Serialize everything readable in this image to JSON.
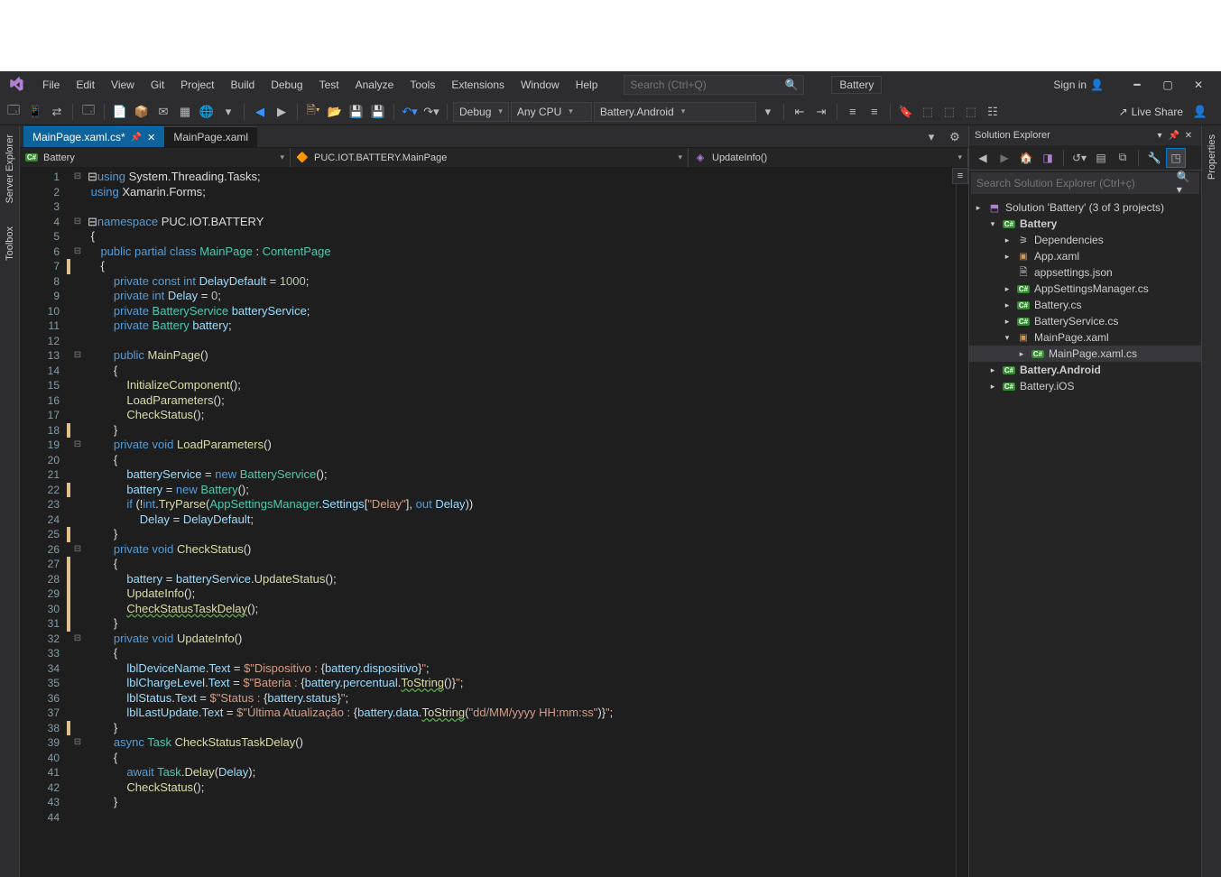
{
  "menu": [
    "File",
    "Edit",
    "View",
    "Git",
    "Project",
    "Build",
    "Debug",
    "Test",
    "Analyze",
    "Tools",
    "Extensions",
    "Window",
    "Help"
  ],
  "search_placeholder": "Search (Ctrl+Q)",
  "solution_name_top": "Battery",
  "sign_in": "Sign in",
  "toolbar": {
    "config": "Debug",
    "platform": "Any CPU",
    "startup": "Battery.Android",
    "live_share": "Live Share"
  },
  "tabs": [
    {
      "label": "MainPage.xaml.cs*",
      "active": true,
      "pinned": true
    },
    {
      "label": "MainPage.xaml",
      "active": false,
      "pinned": false
    }
  ],
  "navbar": {
    "project": "Battery",
    "class": "PUC.IOT.BATTERY.MainPage",
    "member": "UpdateInfo()"
  },
  "code": {
    "total_lines": 44,
    "change_markers_yellow": [
      7,
      18,
      22,
      25,
      27,
      28,
      29,
      30,
      31,
      38
    ],
    "fold_minus": [
      1,
      4,
      6,
      13,
      19,
      26,
      32,
      39
    ],
    "lines": [
      [
        {
          "t": "⊟",
          "c": "pn"
        },
        {
          "t": "using ",
          "c": "kw"
        },
        {
          "t": "System.Threading.Tasks",
          "c": "pn"
        },
        {
          "t": ";",
          "c": "pn"
        }
      ],
      [
        {
          "t": " ",
          "c": "pn"
        },
        {
          "t": "using ",
          "c": "kw"
        },
        {
          "t": "Xamarin.Forms",
          "c": "pn"
        },
        {
          "t": ";",
          "c": "pn"
        }
      ],
      [],
      [
        {
          "t": "⊟",
          "c": "pn"
        },
        {
          "t": "namespace ",
          "c": "kw"
        },
        {
          "t": "PUC.IOT.BATTERY",
          "c": "pn"
        }
      ],
      [
        {
          "t": " {",
          "c": "pn"
        }
      ],
      [
        {
          "t": "    ",
          "c": "pn"
        },
        {
          "t": "public partial class ",
          "c": "kw"
        },
        {
          "t": "MainPage",
          "c": "cls"
        },
        {
          "t": " : ",
          "c": "pn"
        },
        {
          "t": "ContentPage",
          "c": "cls"
        }
      ],
      [
        {
          "t": "    {",
          "c": "pn"
        }
      ],
      [
        {
          "t": "        ",
          "c": "pn"
        },
        {
          "t": "private const int ",
          "c": "kw"
        },
        {
          "t": "DelayDefault",
          "c": "var"
        },
        {
          "t": " = ",
          "c": "pn"
        },
        {
          "t": "1000",
          "c": "num"
        },
        {
          "t": ";",
          "c": "pn"
        }
      ],
      [
        {
          "t": "        ",
          "c": "pn"
        },
        {
          "t": "private int ",
          "c": "kw"
        },
        {
          "t": "Delay",
          "c": "var"
        },
        {
          "t": " = ",
          "c": "pn"
        },
        {
          "t": "0",
          "c": "num"
        },
        {
          "t": ";",
          "c": "pn"
        }
      ],
      [
        {
          "t": "        ",
          "c": "pn"
        },
        {
          "t": "private ",
          "c": "kw"
        },
        {
          "t": "BatteryService ",
          "c": "cls"
        },
        {
          "t": "batteryService",
          "c": "var"
        },
        {
          "t": ";",
          "c": "pn"
        }
      ],
      [
        {
          "t": "        ",
          "c": "pn"
        },
        {
          "t": "private ",
          "c": "kw"
        },
        {
          "t": "Battery ",
          "c": "cls"
        },
        {
          "t": "battery",
          "c": "var"
        },
        {
          "t": ";",
          "c": "pn"
        }
      ],
      [],
      [
        {
          "t": "        ",
          "c": "pn"
        },
        {
          "t": "public ",
          "c": "kw"
        },
        {
          "t": "MainPage",
          "c": "fn"
        },
        {
          "t": "()",
          "c": "pn"
        }
      ],
      [
        {
          "t": "        {",
          "c": "pn"
        }
      ],
      [
        {
          "t": "            ",
          "c": "pn"
        },
        {
          "t": "InitializeComponent",
          "c": "fn"
        },
        {
          "t": "();",
          "c": "pn"
        }
      ],
      [
        {
          "t": "            ",
          "c": "pn"
        },
        {
          "t": "LoadParameters",
          "c": "fn"
        },
        {
          "t": "();",
          "c": "pn"
        }
      ],
      [
        {
          "t": "            ",
          "c": "pn"
        },
        {
          "t": "CheckStatus",
          "c": "fn"
        },
        {
          "t": "();",
          "c": "pn"
        }
      ],
      [
        {
          "t": "        }",
          "c": "pn"
        }
      ],
      [
        {
          "t": "        ",
          "c": "pn"
        },
        {
          "t": "private void ",
          "c": "kw"
        },
        {
          "t": "LoadParameters",
          "c": "fn"
        },
        {
          "t": "()",
          "c": "pn"
        }
      ],
      [
        {
          "t": "        {",
          "c": "pn"
        }
      ],
      [
        {
          "t": "            ",
          "c": "pn"
        },
        {
          "t": "batteryService",
          "c": "var"
        },
        {
          "t": " = ",
          "c": "pn"
        },
        {
          "t": "new ",
          "c": "kw"
        },
        {
          "t": "BatteryService",
          "c": "cls"
        },
        {
          "t": "();",
          "c": "pn"
        }
      ],
      [
        {
          "t": "            ",
          "c": "pn"
        },
        {
          "t": "battery",
          "c": "var"
        },
        {
          "t": " = ",
          "c": "pn"
        },
        {
          "t": "new ",
          "c": "kw"
        },
        {
          "t": "Battery",
          "c": "cls"
        },
        {
          "t": "();",
          "c": "pn"
        }
      ],
      [
        {
          "t": "            ",
          "c": "pn"
        },
        {
          "t": "if ",
          "c": "kw"
        },
        {
          "t": "(!",
          "c": "pn"
        },
        {
          "t": "int",
          "c": "kw"
        },
        {
          "t": ".",
          "c": "pn"
        },
        {
          "t": "TryParse",
          "c": "fn"
        },
        {
          "t": "(",
          "c": "pn"
        },
        {
          "t": "AppSettingsManager",
          "c": "cls"
        },
        {
          "t": ".",
          "c": "pn"
        },
        {
          "t": "Settings",
          "c": "var"
        },
        {
          "t": "[",
          "c": "pn"
        },
        {
          "t": "\"Delay\"",
          "c": "str"
        },
        {
          "t": "], ",
          "c": "pn"
        },
        {
          "t": "out ",
          "c": "kw"
        },
        {
          "t": "Delay",
          "c": "var"
        },
        {
          "t": "))",
          "c": "pn"
        }
      ],
      [
        {
          "t": "                ",
          "c": "pn"
        },
        {
          "t": "Delay",
          "c": "var"
        },
        {
          "t": " = ",
          "c": "pn"
        },
        {
          "t": "DelayDefault",
          "c": "var"
        },
        {
          "t": ";",
          "c": "pn"
        }
      ],
      [
        {
          "t": "        }",
          "c": "pn"
        }
      ],
      [
        {
          "t": "        ",
          "c": "pn"
        },
        {
          "t": "private void ",
          "c": "kw"
        },
        {
          "t": "CheckStatus",
          "c": "fn"
        },
        {
          "t": "()",
          "c": "pn"
        }
      ],
      [
        {
          "t": "        {",
          "c": "pn"
        }
      ],
      [
        {
          "t": "            ",
          "c": "pn"
        },
        {
          "t": "battery",
          "c": "var"
        },
        {
          "t": " = ",
          "c": "pn"
        },
        {
          "t": "batteryService",
          "c": "var"
        },
        {
          "t": ".",
          "c": "pn"
        },
        {
          "t": "UpdateStatus",
          "c": "fn"
        },
        {
          "t": "();",
          "c": "pn"
        }
      ],
      [
        {
          "t": "            ",
          "c": "pn"
        },
        {
          "t": "UpdateInfo",
          "c": "fn"
        },
        {
          "t": "();",
          "c": "pn"
        }
      ],
      [
        {
          "t": "            ",
          "c": "pn"
        },
        {
          "t": "CheckStatusTaskDelay",
          "c": "fn sq"
        },
        {
          "t": "();",
          "c": "pn"
        }
      ],
      [
        {
          "t": "        }",
          "c": "pn"
        }
      ],
      [
        {
          "t": "        ",
          "c": "pn"
        },
        {
          "t": "private void ",
          "c": "kw"
        },
        {
          "t": "UpdateInfo",
          "c": "fn"
        },
        {
          "t": "()",
          "c": "pn"
        }
      ],
      [
        {
          "t": "        {",
          "c": "pn"
        }
      ],
      [
        {
          "t": "            ",
          "c": "pn"
        },
        {
          "t": "lblDeviceName",
          "c": "var"
        },
        {
          "t": ".",
          "c": "pn"
        },
        {
          "t": "Text",
          "c": "var"
        },
        {
          "t": " = ",
          "c": "pn"
        },
        {
          "t": "$\"Dispositivo : ",
          "c": "str"
        },
        {
          "t": "{",
          "c": "pn"
        },
        {
          "t": "battery",
          "c": "var"
        },
        {
          "t": ".",
          "c": "pn"
        },
        {
          "t": "dispositivo",
          "c": "var"
        },
        {
          "t": "}",
          "c": "pn"
        },
        {
          "t": "\"",
          "c": "str"
        },
        {
          "t": ";",
          "c": "pn"
        }
      ],
      [
        {
          "t": "            ",
          "c": "pn"
        },
        {
          "t": "lblChargeLevel",
          "c": "var"
        },
        {
          "t": ".",
          "c": "pn"
        },
        {
          "t": "Text",
          "c": "var"
        },
        {
          "t": " = ",
          "c": "pn"
        },
        {
          "t": "$\"Bateria : ",
          "c": "str"
        },
        {
          "t": "{",
          "c": "pn"
        },
        {
          "t": "battery",
          "c": "var"
        },
        {
          "t": ".",
          "c": "pn"
        },
        {
          "t": "percentual",
          "c": "var"
        },
        {
          "t": ".",
          "c": "pn"
        },
        {
          "t": "ToString",
          "c": "fn sq"
        },
        {
          "t": "()",
          "c": "pn"
        },
        {
          "t": "}",
          "c": "pn"
        },
        {
          "t": "\"",
          "c": "str"
        },
        {
          "t": ";",
          "c": "pn"
        }
      ],
      [
        {
          "t": "            ",
          "c": "pn"
        },
        {
          "t": "lblStatus",
          "c": "var"
        },
        {
          "t": ".",
          "c": "pn"
        },
        {
          "t": "Text",
          "c": "var"
        },
        {
          "t": " = ",
          "c": "pn"
        },
        {
          "t": "$\"Status : ",
          "c": "str"
        },
        {
          "t": "{",
          "c": "pn"
        },
        {
          "t": "battery",
          "c": "var"
        },
        {
          "t": ".",
          "c": "pn"
        },
        {
          "t": "status",
          "c": "var"
        },
        {
          "t": "}",
          "c": "pn"
        },
        {
          "t": "\"",
          "c": "str"
        },
        {
          "t": ";",
          "c": "pn"
        }
      ],
      [
        {
          "t": "            ",
          "c": "pn"
        },
        {
          "t": "lblLastUpdate",
          "c": "var"
        },
        {
          "t": ".",
          "c": "pn"
        },
        {
          "t": "Text",
          "c": "var"
        },
        {
          "t": " = ",
          "c": "pn"
        },
        {
          "t": "$\"Última Atualização : ",
          "c": "str"
        },
        {
          "t": "{",
          "c": "pn"
        },
        {
          "t": "battery",
          "c": "var"
        },
        {
          "t": ".",
          "c": "pn"
        },
        {
          "t": "data",
          "c": "var"
        },
        {
          "t": ".",
          "c": "pn"
        },
        {
          "t": "ToString",
          "c": "fn sq"
        },
        {
          "t": "(",
          "c": "pn"
        },
        {
          "t": "\"dd/MM/yyyy HH:mm:ss\"",
          "c": "str"
        },
        {
          "t": ")",
          "c": "pn"
        },
        {
          "t": "}",
          "c": "pn"
        },
        {
          "t": "\"",
          "c": "str"
        },
        {
          "t": ";",
          "c": "pn"
        }
      ],
      [
        {
          "t": "        }",
          "c": "pn"
        }
      ],
      [
        {
          "t": "        ",
          "c": "pn"
        },
        {
          "t": "async ",
          "c": "kw"
        },
        {
          "t": "Task ",
          "c": "cls"
        },
        {
          "t": "CheckStatusTaskDelay",
          "c": "fn"
        },
        {
          "t": "()",
          "c": "pn"
        }
      ],
      [
        {
          "t": "        {",
          "c": "pn"
        }
      ],
      [
        {
          "t": "            ",
          "c": "pn"
        },
        {
          "t": "await ",
          "c": "kw"
        },
        {
          "t": "Task",
          "c": "cls"
        },
        {
          "t": ".",
          "c": "pn"
        },
        {
          "t": "Delay",
          "c": "fn"
        },
        {
          "t": "(",
          "c": "pn"
        },
        {
          "t": "Delay",
          "c": "var"
        },
        {
          "t": ");",
          "c": "pn"
        }
      ],
      [
        {
          "t": "            ",
          "c": "pn"
        },
        {
          "t": "CheckStatus",
          "c": "fn"
        },
        {
          "t": "();",
          "c": "pn"
        }
      ],
      [
        {
          "t": "        }",
          "c": "pn"
        }
      ],
      []
    ]
  },
  "solution_explorer": {
    "title": "Solution Explorer",
    "search_placeholder": "Search Solution Explorer (Ctrl+ç)",
    "root": "Solution 'Battery' (3 of 3 projects)",
    "tree": [
      {
        "indent": 0,
        "exp": "▸",
        "icon": "sln",
        "label": "Solution 'Battery' (3 of 3 projects)",
        "bold": false,
        "exp_open": true
      },
      {
        "indent": 1,
        "exp": "▾",
        "icon": "csproj",
        "label": "Battery",
        "bold": true
      },
      {
        "indent": 2,
        "exp": "▸",
        "icon": "dep",
        "label": "Dependencies"
      },
      {
        "indent": 2,
        "exp": "▸",
        "icon": "xaml",
        "label": "App.xaml"
      },
      {
        "indent": 2,
        "exp": "",
        "icon": "json",
        "label": "appsettings.json"
      },
      {
        "indent": 2,
        "exp": "▸",
        "icon": "cs",
        "label": "AppSettingsManager.cs"
      },
      {
        "indent": 2,
        "exp": "▸",
        "icon": "cs",
        "label": "Battery.cs"
      },
      {
        "indent": 2,
        "exp": "▸",
        "icon": "cs",
        "label": "BatteryService.cs"
      },
      {
        "indent": 2,
        "exp": "▾",
        "icon": "xaml",
        "label": "MainPage.xaml"
      },
      {
        "indent": 3,
        "exp": "▸",
        "icon": "cs",
        "label": "MainPage.xaml.cs",
        "sel": true
      },
      {
        "indent": 1,
        "exp": "▸",
        "icon": "csproj",
        "label": "Battery.Android",
        "bold": true
      },
      {
        "indent": 1,
        "exp": "▸",
        "icon": "csproj",
        "label": "Battery.iOS"
      }
    ]
  },
  "left_tabs": [
    "Server Explorer",
    "Toolbox"
  ],
  "right_tabs": [
    "Properties"
  ]
}
